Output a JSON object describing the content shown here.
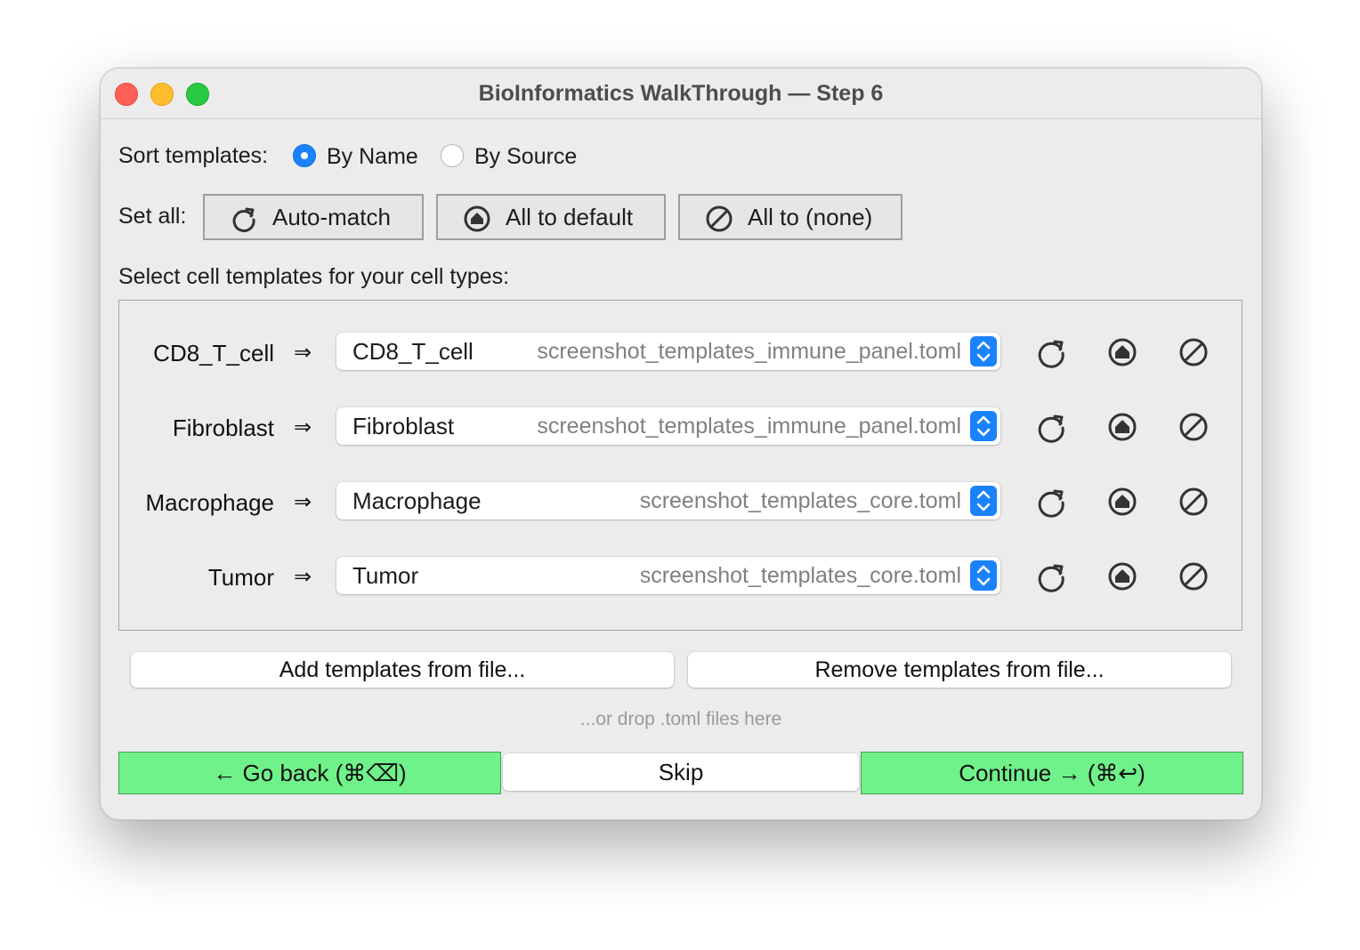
{
  "window": {
    "title": "BioInformatics WalkThrough — Step 6"
  },
  "sort": {
    "label": "Sort templates:",
    "options": [
      {
        "label": "By Name",
        "selected": true
      },
      {
        "label": "By Source",
        "selected": false
      }
    ]
  },
  "set_all": {
    "label": "Set all:",
    "buttons": [
      {
        "label": "Auto-match",
        "icon": "refresh-icon"
      },
      {
        "label": "All to default",
        "icon": "default-icon"
      },
      {
        "label": "All to (none)",
        "icon": "none-icon"
      }
    ]
  },
  "instructions": "Select cell templates for your cell types:",
  "arrow_glyph": "⇒",
  "rows": [
    {
      "cell_type": "CD8_T_cell",
      "template": "CD8_T_cell",
      "source": "screenshot_templates_immune_panel.toml"
    },
    {
      "cell_type": "Fibroblast",
      "template": "Fibroblast",
      "source": "screenshot_templates_immune_panel.toml"
    },
    {
      "cell_type": "Macrophage",
      "template": "Macrophage",
      "source": "screenshot_templates_core.toml"
    },
    {
      "cell_type": "Tumor",
      "template": "Tumor",
      "source": "screenshot_templates_core.toml"
    }
  ],
  "file_buttons": {
    "add": "Add templates from file...",
    "remove": "Remove templates from file..."
  },
  "drop_hint": "...or drop .toml files here",
  "nav": {
    "back": "← Go back (⌘⌫)",
    "skip": "Skip",
    "continue": "Continue → (⌘↩)"
  },
  "colors": {
    "accent": "#1a82fb",
    "nav_green": "#6ff28a",
    "window_bg": "#ececec"
  }
}
